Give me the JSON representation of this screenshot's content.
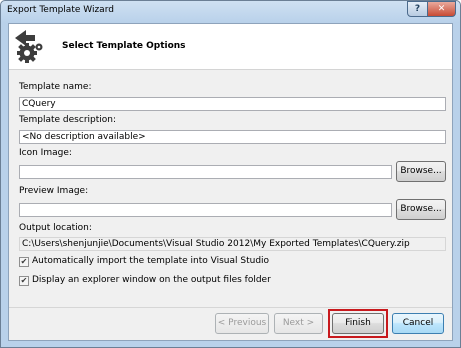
{
  "window": {
    "title": "Export Template Wizard",
    "help_glyph": "?",
    "close_glyph": "✕"
  },
  "header": {
    "title": "Select Template Options",
    "icon": "export-wizard-gear-arrow-icon"
  },
  "form": {
    "template_name_label": "Template name:",
    "template_name_value": "CQuery",
    "template_description_label": "Template description:",
    "template_description_value": "<No description available>",
    "icon_image_label": "Icon Image:",
    "icon_image_value": "",
    "preview_image_label": "Preview Image:",
    "preview_image_value": "",
    "browse_label": "Browse...",
    "output_location_label": "Output location:",
    "output_location_value": "C:\\Users\\shenjunjie\\Documents\\Visual Studio 2012\\My Exported Templates\\CQuery.zip"
  },
  "options": {
    "auto_import": {
      "label": "Automatically import the template into Visual Studio",
      "checked": true
    },
    "explorer_window": {
      "label": "Display an explorer window on the output files folder",
      "checked": true
    }
  },
  "buttons": {
    "previous": "< Previous",
    "next": "Next >",
    "finish": "Finish",
    "cancel": "Cancel"
  },
  "colors": {
    "highlight": "#c8191d",
    "title_bar": "#b9d1ea"
  }
}
